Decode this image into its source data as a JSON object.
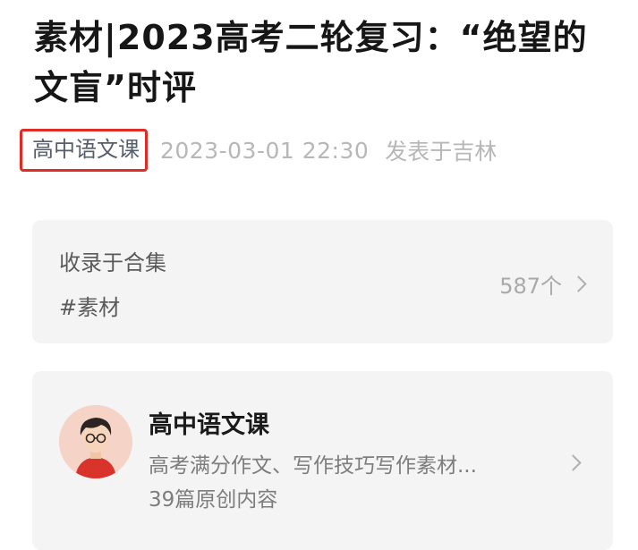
{
  "article": {
    "title": "素材|2023高考二轮复习：“绝望的文盲”时评"
  },
  "meta": {
    "author": "高中语文课",
    "datetime": "2023-03-01 22:30",
    "location": "发表于吉林"
  },
  "collection": {
    "heading": "收录于合集",
    "tag": "#素材",
    "count": "587个"
  },
  "account": {
    "name": "高中语文课",
    "description": "高考满分作文、写作技巧写作素材...",
    "articles": "39篇原创内容"
  },
  "colors": {
    "highlight_box": "#e22b24",
    "card_background": "#f4f4f4",
    "meta_text": "#b7b7b7"
  }
}
